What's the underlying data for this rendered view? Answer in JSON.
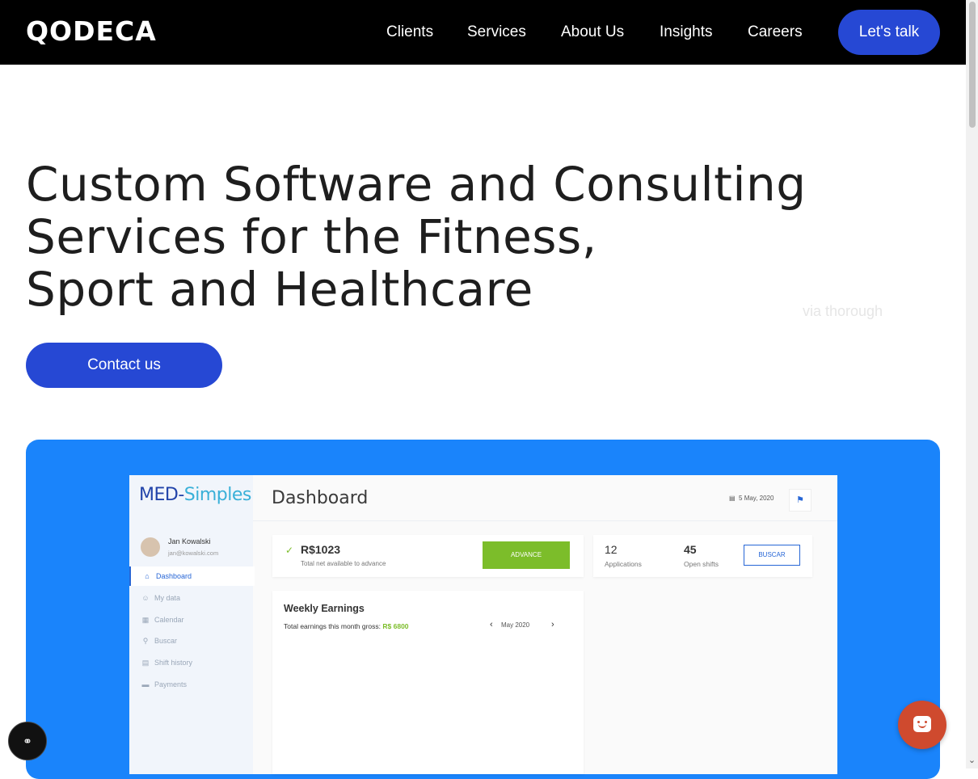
{
  "nav": {
    "logo": "QODECA",
    "links": [
      "Clients",
      "Services",
      "About Us",
      "Insights",
      "Careers"
    ],
    "cta": "Let's talk"
  },
  "hero": {
    "title_lines": [
      "Custom Software and Consulting",
      "Services for the Fitness,",
      "Sport and Healthcare"
    ],
    "rotating_text": "via thorough",
    "contact": "Contact us"
  },
  "app": {
    "logo_main": "MED-",
    "logo_accent": "Simples",
    "user_name": "Jan Kowalski",
    "user_email": "jan@kowalski.com",
    "menu": [
      "Dashboard",
      "My data",
      "Calendar",
      "Buscar",
      "Shift history",
      "Payments"
    ],
    "heading": "Dashboard",
    "date": "5 May, 2020",
    "amount": "R$1023",
    "amount_sub": "Total net available to advance",
    "advance": "ADVANCE",
    "applications_num": "12",
    "applications_lbl": "Applications",
    "shifts_num": "45",
    "shifts_lbl": "Open shifts",
    "buscar": "BUSCAR",
    "weekly_title": "Weekly Earnings",
    "weekly_sub": "Total earnings this month gross:",
    "weekly_value": "R$ 6800",
    "month": "May 2020"
  },
  "colors": {
    "accent": "#2648d4",
    "showcase": "#1a84fb",
    "green": "#7cbd2a",
    "chat": "#cf4a2e"
  },
  "icons": [
    "accessibility-icon",
    "chat-icon",
    "calendar-icon",
    "bell-icon",
    "check-icon",
    "chevron-left-icon",
    "chevron-right-icon"
  ]
}
